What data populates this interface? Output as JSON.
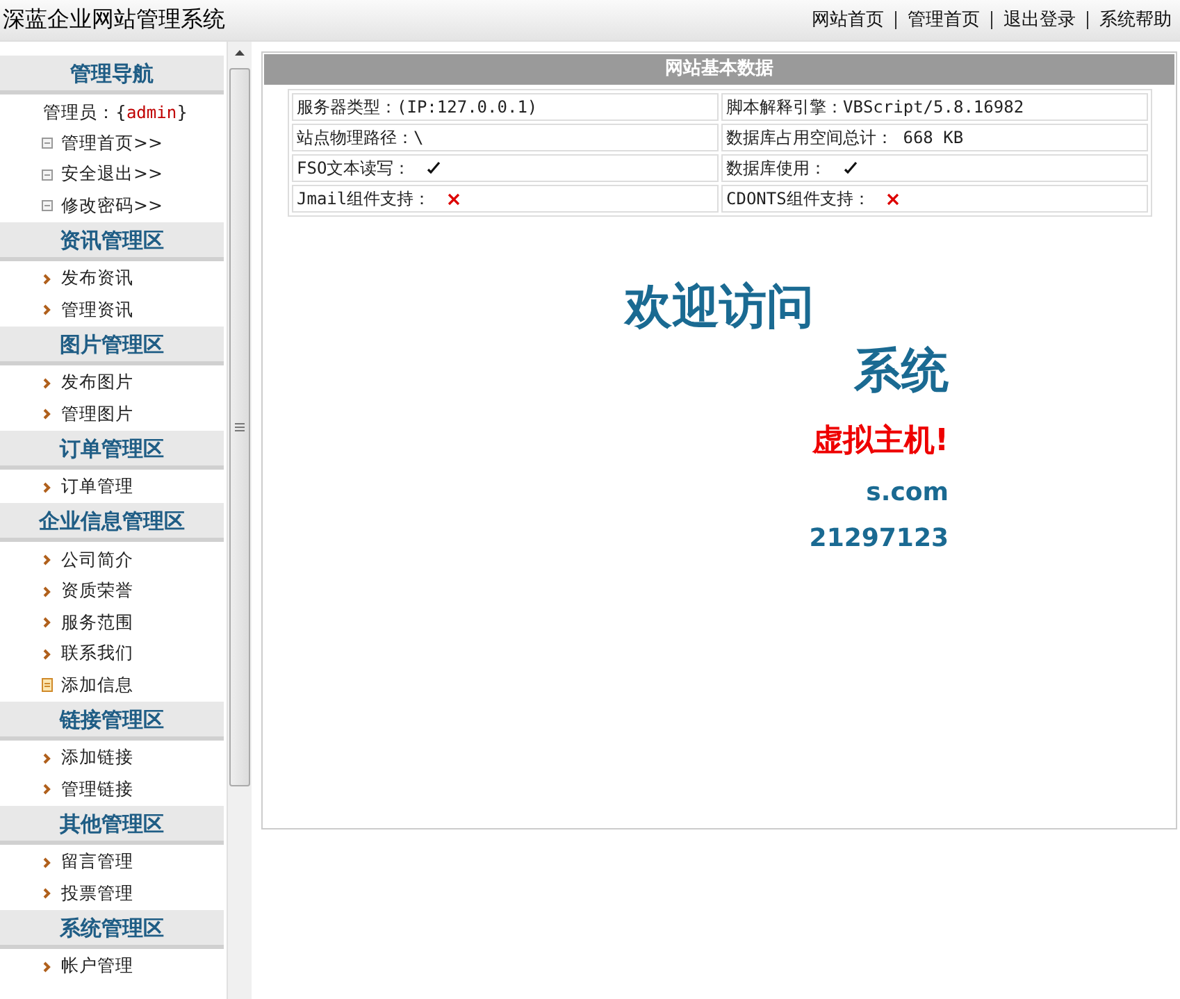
{
  "header": {
    "title": "深蓝企业网站管理系统",
    "links": [
      "网站首页",
      "管理首页",
      "退出登录",
      "系统帮助"
    ]
  },
  "sidebar": {
    "sections": [
      {
        "title": "管理导航",
        "admin": {
          "label": "管理员：{",
          "name": "admin",
          "suffix": "}"
        },
        "items": [
          {
            "label": "管理首页>>",
            "kind": "box"
          },
          {
            "label": "安全退出>>",
            "kind": "box"
          },
          {
            "label": "修改密码>>",
            "kind": "box"
          }
        ]
      },
      {
        "title": "资讯管理区",
        "items": [
          {
            "label": "发布资讯",
            "kind": "arrow"
          },
          {
            "label": "管理资讯",
            "kind": "arrow"
          }
        ]
      },
      {
        "title": "图片管理区",
        "items": [
          {
            "label": "发布图片",
            "kind": "arrow"
          },
          {
            "label": "管理图片",
            "kind": "arrow"
          }
        ]
      },
      {
        "title": "订单管理区",
        "items": [
          {
            "label": "订单管理",
            "kind": "arrow"
          }
        ]
      },
      {
        "title": "企业信息管理区",
        "items": [
          {
            "label": "公司简介",
            "kind": "arrow"
          },
          {
            "label": "资质荣誉",
            "kind": "arrow"
          },
          {
            "label": "服务范围",
            "kind": "arrow"
          },
          {
            "label": "联系我们",
            "kind": "arrow"
          },
          {
            "label": "添加信息",
            "kind": "doc"
          }
        ]
      },
      {
        "title": "链接管理区",
        "items": [
          {
            "label": "添加链接",
            "kind": "arrow"
          },
          {
            "label": "管理链接",
            "kind": "arrow"
          }
        ]
      },
      {
        "title": "其他管理区",
        "items": [
          {
            "label": "留言管理",
            "kind": "arrow"
          },
          {
            "label": "投票管理",
            "kind": "arrow"
          }
        ]
      },
      {
        "title": "系统管理区",
        "items": [
          {
            "label": "帐户管理",
            "kind": "arrow"
          }
        ]
      }
    ]
  },
  "panel": {
    "title": "网站基本数据",
    "rows": [
      [
        {
          "kind": "text",
          "text": "服务器类型：(IP:127.0.0.1)"
        },
        {
          "kind": "text",
          "text": "脚本解释引擎：VBScript/5.8.16982"
        }
      ],
      [
        {
          "kind": "text",
          "text": "站点物理路径：\\"
        },
        {
          "kind": "text",
          "text": "数据库占用空间总计： 668 KB"
        }
      ],
      [
        {
          "kind": "status",
          "text": "FSO文本读写：",
          "supported": true
        },
        {
          "kind": "status",
          "text": "数据库使用：",
          "supported": true
        }
      ],
      [
        {
          "kind": "status",
          "text": "Jmail组件支持：",
          "supported": false
        },
        {
          "kind": "status",
          "text": "CDONTS组件支持：",
          "supported": false
        }
      ]
    ]
  },
  "welcome": [
    {
      "text": "欢迎访问",
      "kind": "heading"
    },
    {
      "text": "系统",
      "kind": "heading"
    },
    {
      "text": "虚拟主机!",
      "kind": "alert"
    },
    {
      "text": "s.com",
      "kind": "small"
    },
    {
      "text": "21297123",
      "kind": "small"
    }
  ]
}
